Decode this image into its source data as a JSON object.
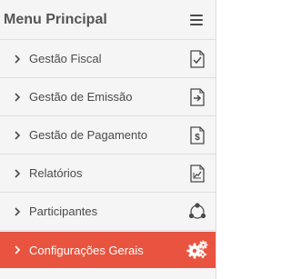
{
  "menu": {
    "title": "Menu Principal",
    "toggle_icon": "hamburger-icon",
    "items": [
      {
        "label": "Gestão Fiscal",
        "icon": "document-check-icon"
      },
      {
        "label": "Gestão de Emissão",
        "icon": "document-export-icon"
      },
      {
        "label": "Gestão de Pagamento",
        "icon": "document-dollar-icon"
      },
      {
        "label": "Relatórios",
        "icon": "document-chart-icon"
      },
      {
        "label": "Participantes",
        "icon": "network-icon"
      },
      {
        "label": "Configurações Gerais",
        "icon": "gears-icon",
        "active": true
      }
    ]
  },
  "colors": {
    "active_background": "#e8543f",
    "menu_background": "#f5f5f5",
    "text": "#4a4a4a"
  }
}
